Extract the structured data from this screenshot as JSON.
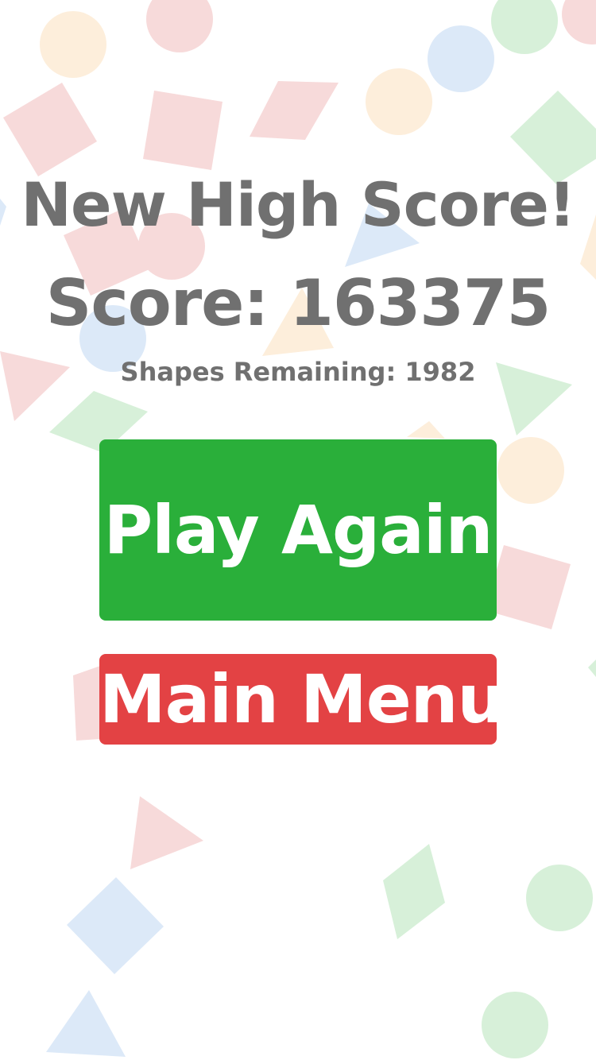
{
  "screen": {
    "title": "New High Score!",
    "score_text": "Score: 163375",
    "remaining_text": "Shapes Remaining: 1982"
  },
  "buttons": {
    "play_again": "Play Again",
    "main_menu": "Main Menu"
  },
  "colors": {
    "text": "#707070",
    "play_again_bg": "#2aaf3a",
    "main_menu_bg": "#e34244",
    "shape_red": "#f7dada",
    "shape_blue": "#dce9f8",
    "shape_green": "#d7f0d9",
    "shape_orange": "#fdeedb"
  }
}
